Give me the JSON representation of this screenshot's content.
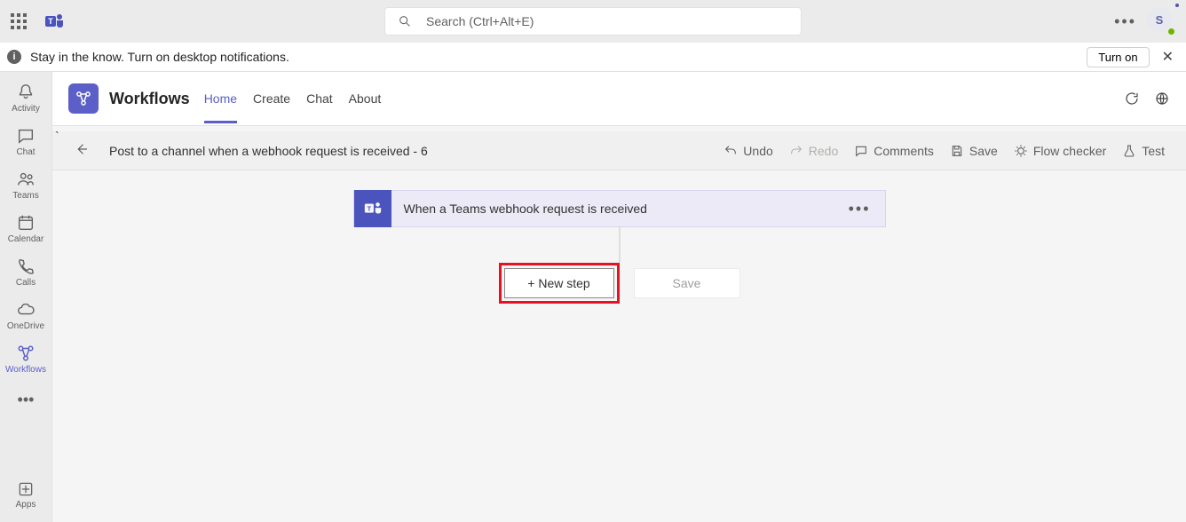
{
  "topbar": {
    "search_placeholder": "Search (Ctrl+Alt+E)",
    "avatar_initial": "S"
  },
  "notification": {
    "text": "Stay in the know. Turn on desktop notifications.",
    "turn_on_label": "Turn on"
  },
  "rail": {
    "items": [
      {
        "label": "Activity"
      },
      {
        "label": "Chat"
      },
      {
        "label": "Teams"
      },
      {
        "label": "Calendar"
      },
      {
        "label": "Calls"
      },
      {
        "label": "OneDrive"
      },
      {
        "label": "Workflows"
      }
    ],
    "apps_label": "Apps"
  },
  "workflows": {
    "title": "Workflows",
    "tabs": [
      {
        "label": "Home"
      },
      {
        "label": "Create"
      },
      {
        "label": "Chat"
      },
      {
        "label": "About"
      }
    ]
  },
  "flow_toolbar": {
    "flow_name": "Post to a channel when a webhook request is received - 6",
    "undo": "Undo",
    "redo": "Redo",
    "comments": "Comments",
    "save": "Save",
    "checker": "Flow checker",
    "test": "Test"
  },
  "canvas": {
    "trigger_label": "When a Teams webhook request is received",
    "new_step_label": "+ New step",
    "save_label": "Save"
  }
}
